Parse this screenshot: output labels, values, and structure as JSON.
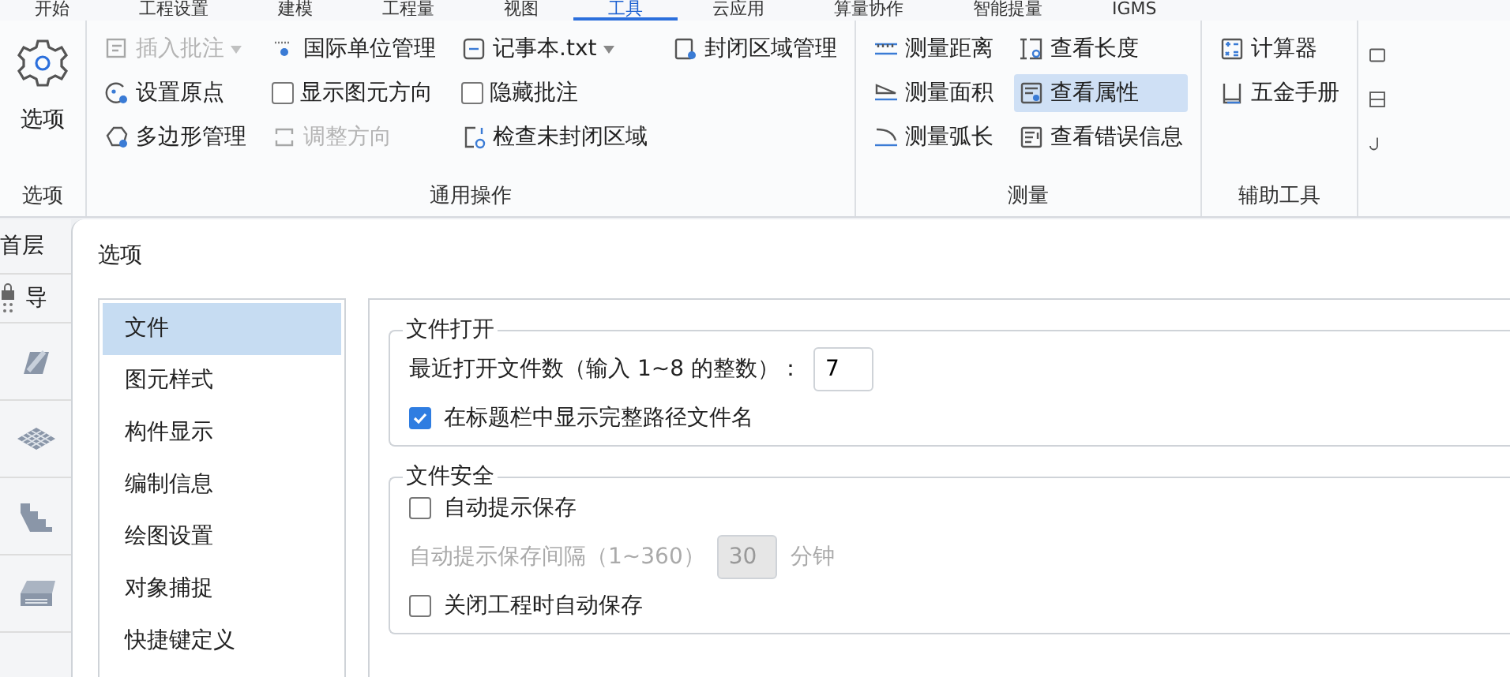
{
  "ribbon_tabs": [
    {
      "label": "开始",
      "selected": false
    },
    {
      "label": "工程设置",
      "selected": false
    },
    {
      "label": "建模",
      "selected": false
    },
    {
      "label": "工程量",
      "selected": false
    },
    {
      "label": "视图",
      "selected": false
    },
    {
      "label": "工具",
      "selected": true
    },
    {
      "label": "云应用",
      "selected": false
    },
    {
      "label": "算量协作",
      "selected": false
    },
    {
      "label": "智能提量",
      "selected": false
    },
    {
      "label": "IGMS",
      "selected": false
    }
  ],
  "ribbon_groups": [
    {
      "title": "选项",
      "large_button": {
        "label": "选项"
      }
    },
    {
      "title": "通用操作",
      "columns": [
        [
          {
            "kind": "button",
            "label": "插入批注",
            "disabled": true,
            "dropdown": true
          },
          {
            "kind": "button",
            "label": "设置原点",
            "disabled": false
          },
          {
            "kind": "button",
            "label": "多边形管理",
            "disabled": false
          }
        ],
        [
          {
            "kind": "button",
            "label": "国际单位管理",
            "disabled": false
          },
          {
            "kind": "checkbox",
            "label": "显示图元方向",
            "checked": false
          },
          {
            "kind": "button",
            "label": "调整方向",
            "disabled": true
          }
        ],
        [
          {
            "kind": "button",
            "label": "记事本.txt",
            "disabled": false,
            "dropdown": true
          },
          {
            "kind": "checkbox",
            "label": "隐藏批注",
            "checked": false
          },
          {
            "kind": "button",
            "label": "检查未封闭区域",
            "disabled": false
          }
        ],
        [
          {
            "kind": "button",
            "label": "封闭区域管理",
            "disabled": false
          }
        ]
      ]
    },
    {
      "title": "测量",
      "columns": [
        [
          {
            "kind": "button",
            "label": "测量距离",
            "disabled": false,
            "selected": false
          },
          {
            "kind": "button",
            "label": "测量面积",
            "disabled": false,
            "selected": false
          },
          {
            "kind": "button",
            "label": "测量弧长",
            "disabled": false,
            "selected": false
          }
        ],
        [
          {
            "kind": "button",
            "label": "查看长度",
            "disabled": false,
            "selected": false
          },
          {
            "kind": "button",
            "label": "查看属性",
            "disabled": false,
            "selected": true
          },
          {
            "kind": "button",
            "label": "查看错误信息",
            "disabled": false,
            "selected": false
          }
        ]
      ]
    },
    {
      "title": "辅助工具",
      "columns": [
        [
          {
            "kind": "button",
            "label": "计算器",
            "disabled": false
          },
          {
            "kind": "button",
            "label": "五金手册",
            "disabled": false
          }
        ]
      ]
    }
  ],
  "side_strip": {
    "floor": "首层",
    "nav_label": "导"
  },
  "dialog": {
    "title": "选项",
    "nav_items": [
      {
        "label": "文件",
        "selected": true
      },
      {
        "label": "图元样式",
        "selected": false
      },
      {
        "label": "构件显示",
        "selected": false
      },
      {
        "label": "编制信息",
        "selected": false
      },
      {
        "label": "绘图设置",
        "selected": false
      },
      {
        "label": "对象捕捉",
        "selected": false
      },
      {
        "label": "快捷键定义",
        "selected": false
      }
    ],
    "sections": [
      {
        "title": "文件打开",
        "rows": [
          {
            "kind": "input",
            "label": "最近打开文件数（输入 1~8 的整数）：",
            "value": "7",
            "disabled": false
          },
          {
            "kind": "checkbox",
            "label": "在标题栏中显示完整路径文件名",
            "checked": true
          }
        ]
      },
      {
        "title": "文件安全",
        "rows": [
          {
            "kind": "checkbox",
            "label": "自动提示保存",
            "checked": false
          },
          {
            "kind": "input",
            "label": "自动提示保存间隔（1~360）",
            "value": "30",
            "unit": "分钟",
            "disabled": true
          },
          {
            "kind": "checkbox",
            "label": "关闭工程时自动保存",
            "checked": false
          }
        ]
      }
    ]
  }
}
